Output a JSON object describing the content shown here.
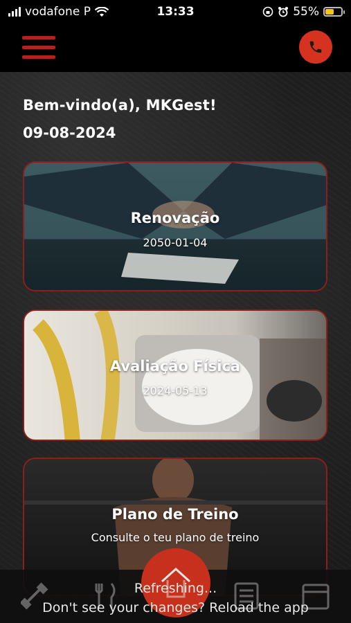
{
  "status_bar": {
    "carrier": "vodafone P",
    "time": "13:33",
    "battery": "55%",
    "battery_level": 0.55,
    "icons": [
      "signal-icon",
      "wifi-icon",
      "screen-lock-icon",
      "alarm-icon",
      "battery-icon"
    ]
  },
  "header": {
    "menu_icon": "hamburger-icon",
    "phone_icon": "phone-icon",
    "accent_color": "#d5331f"
  },
  "welcome": {
    "greeting": "Bem-vindo(a), MKGest!",
    "date": "09-08-2024"
  },
  "cards": [
    {
      "title": "Renovação",
      "subtitle": "2050-01-04"
    },
    {
      "title": "Avaliação Física",
      "subtitle": "2024-05-13"
    },
    {
      "title": "Plano de Treino",
      "subtitle": "Consulte o teu plano de treino"
    }
  ],
  "bottom_nav": {
    "icons": [
      "dumbbell-icon",
      "cutlery-icon",
      "home-icon",
      "list-icon",
      "calendar-icon"
    ]
  },
  "refresh_banner": {
    "line1": "Refreshing...",
    "line2": "Don't see your changes? Reload the app"
  }
}
